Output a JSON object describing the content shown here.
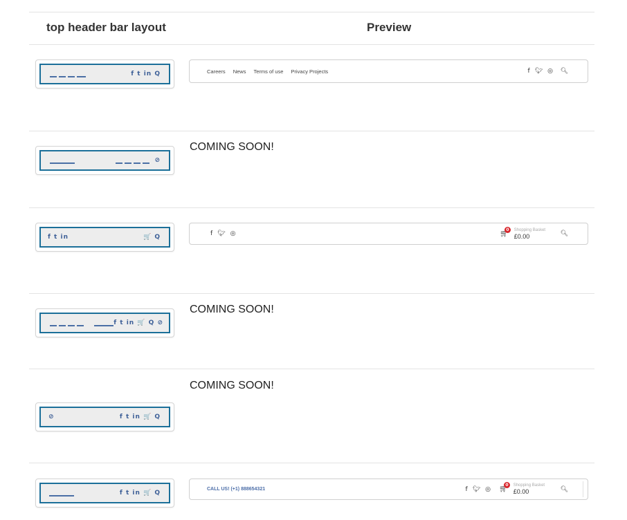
{
  "headers": {
    "layout": "top header bar layout",
    "preview": "Preview"
  },
  "coming_soon": "COMING SOON!",
  "thumbnails": [
    {
      "icons": "f t in Q"
    },
    {
      "icons": "⊘"
    },
    {
      "left_icons": "f t in",
      "right_icons": "🛒 Q"
    },
    {
      "icons": "f t in 🛒 Q ⊘"
    },
    {
      "left_icons": "⊘",
      "icons": "f t in 🛒 Q"
    },
    {
      "icons": "f t in 🛒 Q"
    }
  ],
  "preview1": {
    "links": [
      "Careers",
      "News",
      "Terms of use",
      "Privacy Projects"
    ],
    "social": [
      "facebook-icon",
      "twitter-icon",
      "instagram-icon"
    ],
    "search_icon": "search-icon"
  },
  "preview2": {
    "basket_label": "Shopping Basket",
    "basket_amount": "£0.00",
    "basket_count": "0"
  },
  "preview3": {
    "call": "CALL US! (+1) 888654321",
    "basket_label": "Shopping Basket",
    "basket_amount": "£0.00",
    "basket_count": "0"
  },
  "colors": {
    "accent": "#1b6f99",
    "icon": "#3d5f97",
    "badge": "#d9262c"
  }
}
